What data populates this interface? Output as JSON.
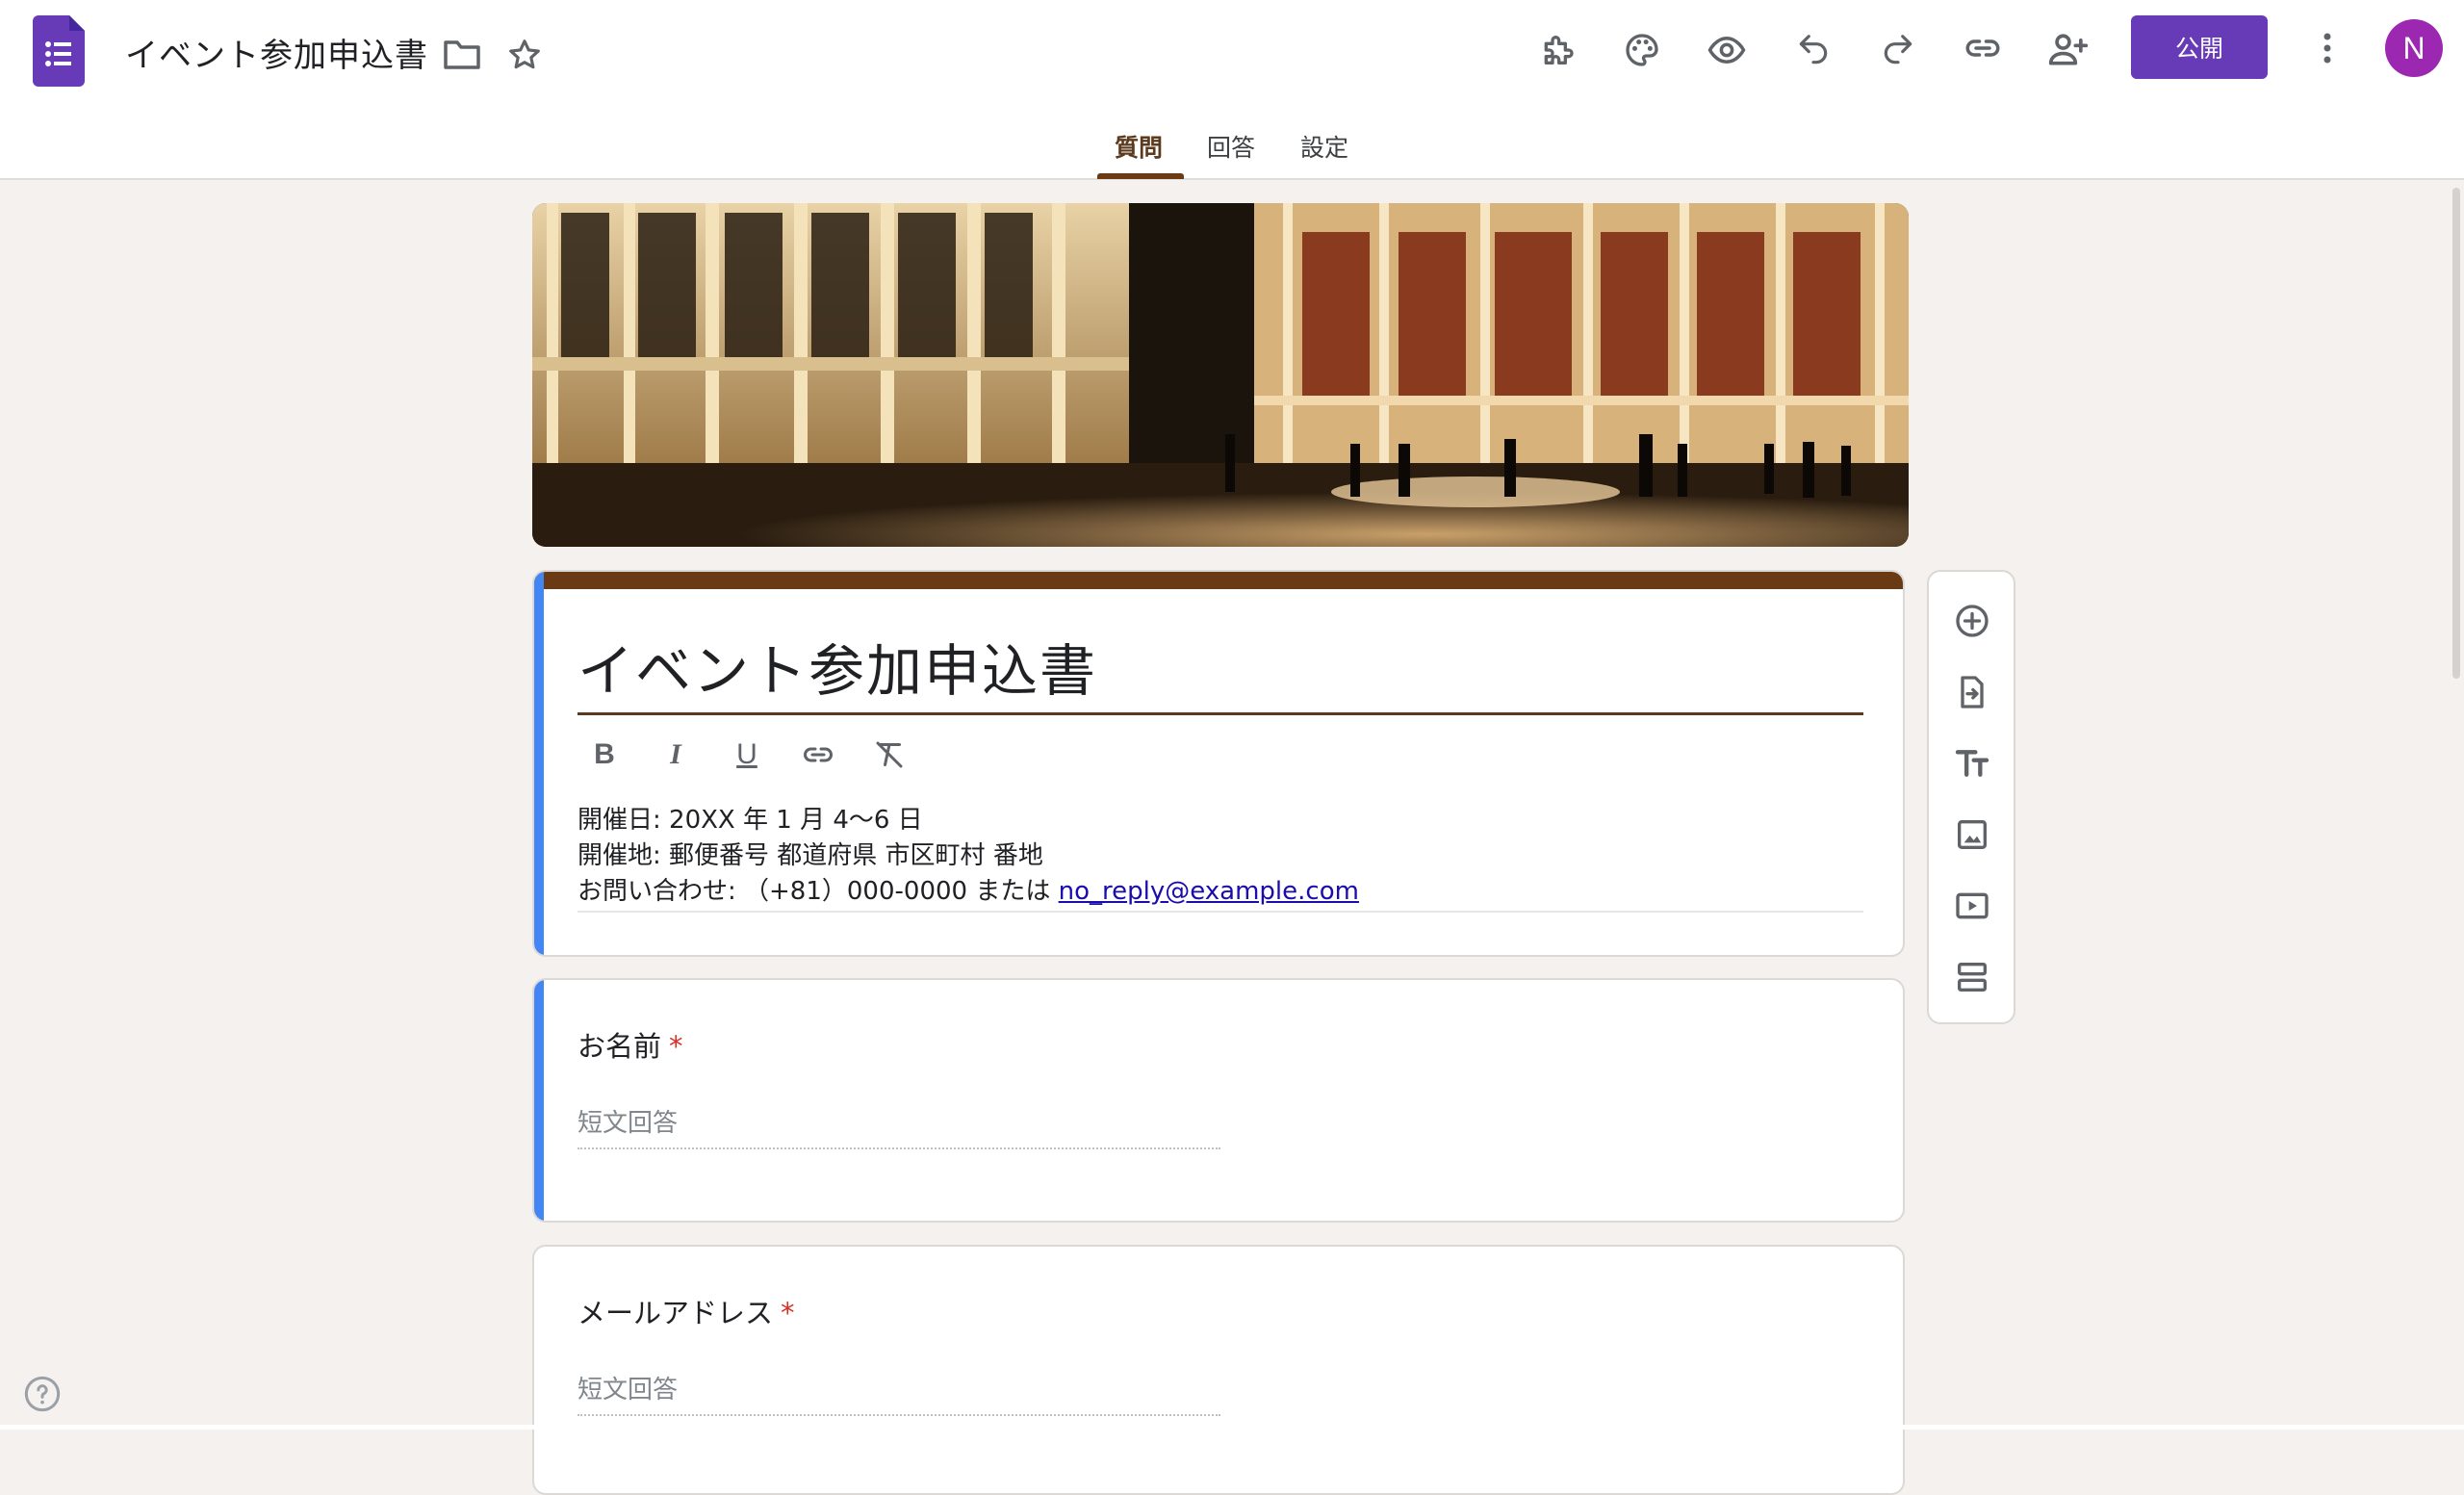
{
  "header": {
    "doc_title": "イベント参加申込書",
    "publish_label": "公開",
    "avatar_initial": "N",
    "icons": [
      "forms-logo-icon",
      "folder-icon",
      "star-icon",
      "add-ons-icon",
      "palette-icon",
      "preview-eye-icon",
      "undo-icon",
      "redo-icon",
      "link-icon",
      "add-collaborator-icon",
      "more-vert-icon"
    ]
  },
  "tabs": [
    {
      "label": "質問",
      "active": true
    },
    {
      "label": "回答",
      "active": false
    },
    {
      "label": "設定",
      "active": false
    }
  ],
  "form": {
    "title": "イベント参加申込書",
    "format_tools": [
      "bold-icon",
      "italic-icon",
      "underline-icon",
      "link-icon",
      "clear-format-icon"
    ],
    "description": {
      "line1": "開催日: 20XX 年 1 月 4〜6 日",
      "line2": "開催地: 郵便番号 都道府県 市区町村 番地",
      "line3_prefix": "お問い合わせ: （+81）000-0000 または ",
      "email": "no_reply@example.com"
    }
  },
  "questions": [
    {
      "title": "お名前",
      "required_mark": "*",
      "placeholder": "短文回答"
    },
    {
      "title": "メールアドレス",
      "required_mark": "*",
      "placeholder": "短文回答"
    }
  ],
  "side_toolbar": [
    "add-question-icon",
    "import-questions-icon",
    "add-title-icon",
    "add-image-icon",
    "add-video-icon",
    "add-section-icon"
  ],
  "colors": {
    "accent_purple": "#673ab7",
    "theme_brown": "#6a3a14",
    "active_card_blue": "#4285f4",
    "background": "#f4f1ee"
  }
}
